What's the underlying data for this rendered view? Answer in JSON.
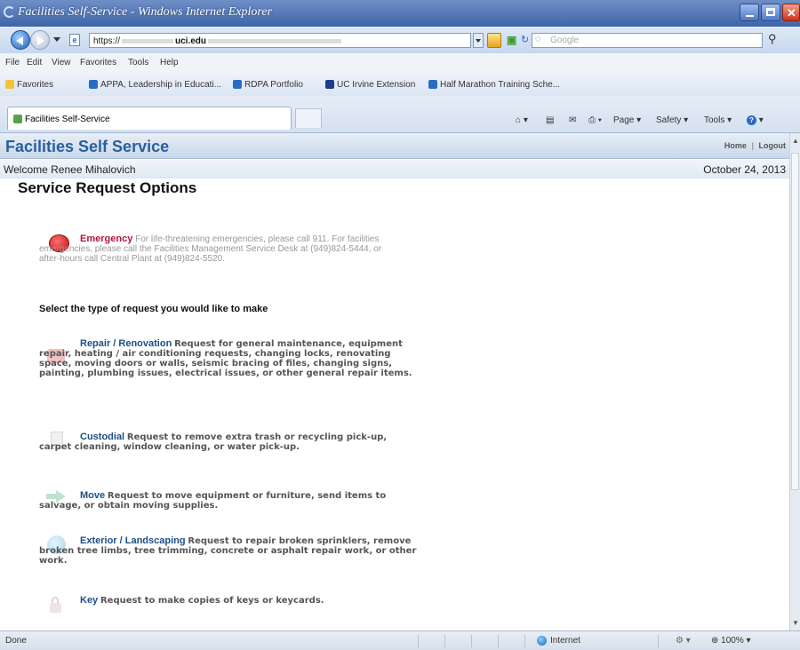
{
  "window": {
    "title": "Facilities Self-Service - Windows Internet Explorer"
  },
  "address": {
    "url_prefix": "https://",
    "url_domain": "uci.edu",
    "search_placeholder": "Google"
  },
  "menu": [
    "File",
    "Edit",
    "View",
    "Favorites",
    "Tools",
    "Help"
  ],
  "favorites": {
    "label": "Favorites",
    "items": [
      "APPA, Leadership in Educati...",
      "RDPA Portfolio",
      "UC Irvine Extension",
      "Half Marathon Training Sche..."
    ]
  },
  "tab": {
    "label": "Facilities Self-Service"
  },
  "commandbar": {
    "page": "Page",
    "safety": "Safety",
    "tools": "Tools"
  },
  "app": {
    "name": "Facilities Self Service",
    "home": "Home",
    "sep": "|",
    "logout": "Logout",
    "welcome": "Welcome Renee Mihalovich",
    "date": "October 24, 2013",
    "page_title": "Service Request Options",
    "emergency": {
      "label": "Emergency",
      "text": "For life-threatening emergencies, please call 911. For facilities emergencies, please call the Facilities Management Service Desk at (949)824-5444, or after-hours call Central Plant at (949)824-5520."
    },
    "select_prompt": "Select the type of request you would like to make",
    "options": [
      {
        "label": "Repair / Renovation",
        "text": "Request for general maintenance, equipment repair, heating / air conditioning requests, changing locks, renovating space, moving doors or walls, seismic bracing of files, changing signs, painting, plumbing issues, electrical issues, or other general repair items."
      },
      {
        "label": "Custodial",
        "text": "Request to remove extra trash or recycling pick-up, carpet cleaning, window cleaning, or water pick-up."
      },
      {
        "label": "Move",
        "text": "Request to move equipment or furniture, send items to salvage, or obtain moving supplies."
      },
      {
        "label": "Exterior / Landscaping",
        "text": "Request to repair broken sprinklers, remove broken tree limbs, tree trimming, concrete or asphalt repair work, or other work."
      },
      {
        "label": "Key",
        "text": "Request to make copies of keys or keycards."
      }
    ]
  },
  "status": {
    "left": "Done",
    "zone": "Internet",
    "zoom": "100%"
  },
  "colors": {
    "app_title": "#2a5f9e",
    "emergency": "#b5143c",
    "option_label": "#1a4f86"
  }
}
